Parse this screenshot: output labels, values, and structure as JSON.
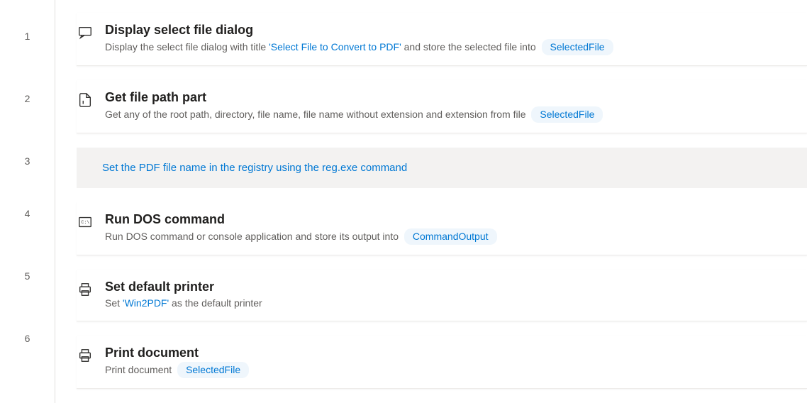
{
  "steps": [
    {
      "number": "1",
      "title": "Display select file dialog",
      "description_prefix": "Display the select file dialog with title ",
      "quoted": "'Select File to Convert to PDF'",
      "description_mid": " and store the selected file into ",
      "variable": "SelectedFile"
    },
    {
      "number": "2",
      "title": "Get file path part",
      "description_prefix": "Get any of the root path, directory, file name, file name without extension and extension from file ",
      "variable": "SelectedFile"
    },
    {
      "number": "3",
      "comment": "Set the PDF file name in the registry using the reg.exe command"
    },
    {
      "number": "4",
      "title": "Run DOS command",
      "description_prefix": "Run DOS command or console application and store its output into ",
      "variable": "CommandOutput"
    },
    {
      "number": "5",
      "title": "Set default printer",
      "description_prefix": "Set ",
      "quoted": "'Win2PDF'",
      "description_mid": " as the default printer"
    },
    {
      "number": "6",
      "title": "Print document",
      "description_prefix": "Print document ",
      "variable": "SelectedFile"
    }
  ]
}
